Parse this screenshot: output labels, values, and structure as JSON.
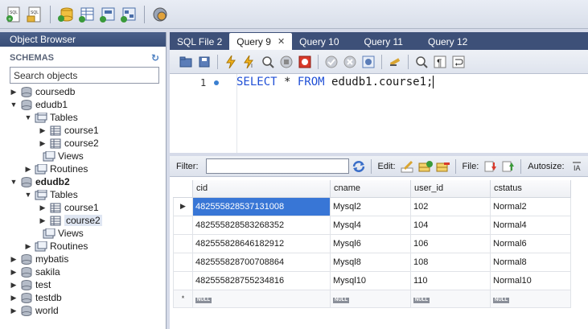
{
  "top_toolbar": {
    "icons": [
      "new-sql-tab-icon",
      "open-sql-script-icon",
      "create-schema-icon",
      "create-table-icon",
      "create-view-icon",
      "create-routine-icon",
      "reconnect-icon"
    ]
  },
  "object_browser": {
    "title": "Object Browser",
    "schemas_label": "SCHEMAS",
    "search_placeholder": "Search objects",
    "tree": {
      "coursedb": "coursedb",
      "edudb1": "edudb1",
      "edudb1_tables": "Tables",
      "edudb1_table1": "course1",
      "edudb1_table2": "course2",
      "edudb1_views": "Views",
      "edudb1_routines": "Routines",
      "edudb2": "edudb2",
      "edudb2_tables": "Tables",
      "edudb2_table1": "course1",
      "edudb2_table2": "course2",
      "edudb2_views": "Views",
      "edudb2_routines": "Routines",
      "mybatis": "mybatis",
      "sakila": "sakila",
      "test": "test",
      "testdb": "testdb",
      "world": "world"
    }
  },
  "tabs": [
    {
      "label": "SQL File 2"
    },
    {
      "label": "Query 9",
      "close": "✕"
    },
    {
      "label": "Query 10"
    },
    {
      "label": "Query 11"
    },
    {
      "label": "Query 12"
    }
  ],
  "editor": {
    "line_number": "1",
    "code": {
      "kw1": "SELECT",
      "star": " * ",
      "kw2": "FROM",
      "rest": " edudb1.course1;"
    }
  },
  "result": {
    "filter_label": "Filter:",
    "edit_label": "Edit:",
    "file_label": "File:",
    "autosize_label": "Autosize:",
    "columns": [
      "cid",
      "cname",
      "user_id",
      "cstatus"
    ],
    "rows": [
      [
        "482555828537131008",
        "Mysql2",
        "102",
        "Normal2"
      ],
      [
        "482555828583268352",
        "Mysql4",
        "104",
        "Normal4"
      ],
      [
        "482555828646182912",
        "Mysql6",
        "106",
        "Normal6"
      ],
      [
        "482555828700708864",
        "Mysql8",
        "108",
        "Normal8"
      ],
      [
        "482555828755234816",
        "Mysql10",
        "110",
        "Normal10"
      ]
    ],
    "null_label": "NULL",
    "current_row_marker": "▶",
    "new_row_marker": "*"
  }
}
